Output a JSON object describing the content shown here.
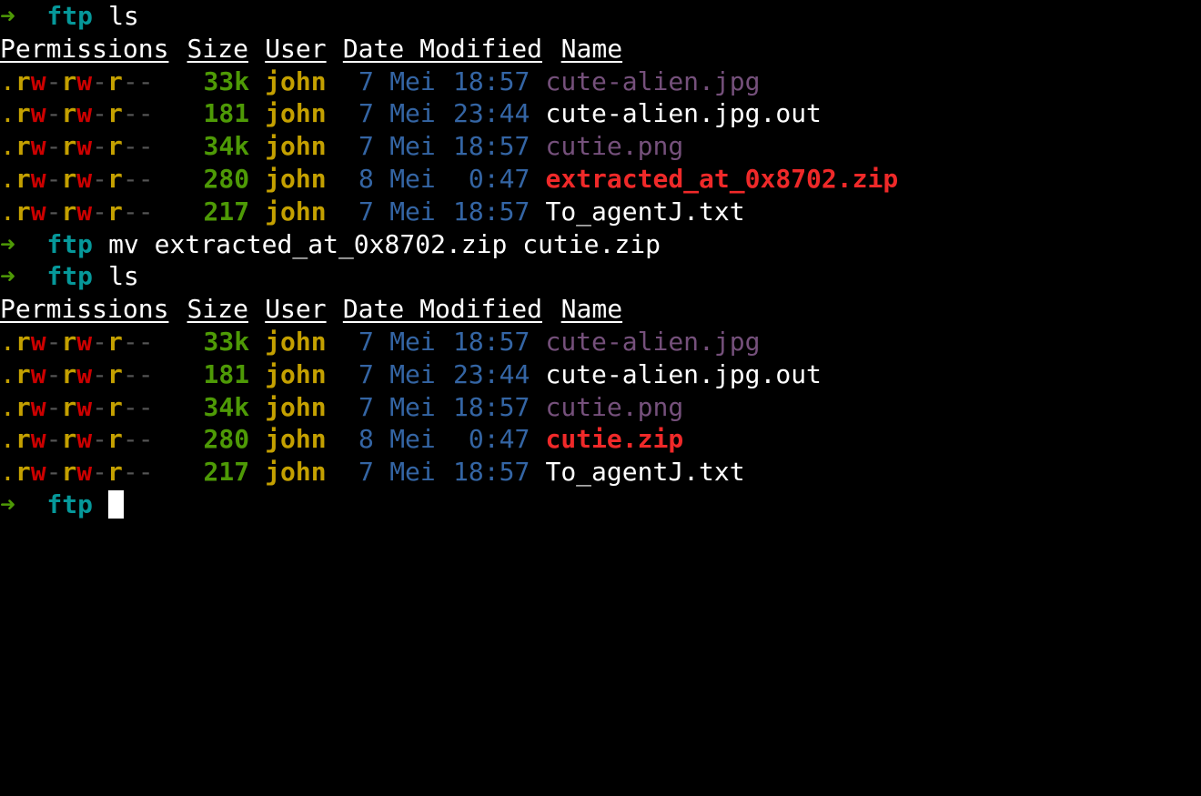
{
  "colors": {
    "background": "#000000",
    "prompt_arrow": "#4e9a06",
    "prompt_dir": "#06989a",
    "perm_dot": "#c4a000",
    "perm_read": "#c4a000",
    "perm_write": "#cc0000",
    "perm_dash": "#555555",
    "size": "#4e9a06",
    "user": "#c4a000",
    "date": "#3465a4",
    "file_image": "#75507b",
    "file_archive": "#ef2929",
    "file_plain": "#ffffff"
  },
  "prompt": {
    "arrow": "➜",
    "dir": "ftp"
  },
  "header": {
    "permissions": "Permissions",
    "size": "Size",
    "user": "User",
    "date_modified": "Date Modified",
    "name": "Name"
  },
  "commands": [
    "ls",
    "mv extracted_at_0x8702.zip cutie.zip",
    "ls"
  ],
  "listing_1": [
    {
      "perm": ".rw-rw-r--",
      "size": "33k",
      "user": "john",
      "day": "7",
      "month": "Mei",
      "time": "18:57",
      "name": "cute-alien.jpg",
      "type": "image"
    },
    {
      "perm": ".rw-rw-r--",
      "size": "181",
      "user": "john",
      "day": "7",
      "month": "Mei",
      "time": "23:44",
      "name": "cute-alien.jpg.out",
      "type": "plain"
    },
    {
      "perm": ".rw-rw-r--",
      "size": "34k",
      "user": "john",
      "day": "7",
      "month": "Mei",
      "time": "18:57",
      "name": "cutie.png",
      "type": "image"
    },
    {
      "perm": ".rw-rw-r--",
      "size": "280",
      "user": "john",
      "day": "8",
      "month": "Mei",
      "time": "0:47",
      "name": "extracted_at_0x8702.zip",
      "type": "archive"
    },
    {
      "perm": ".rw-rw-r--",
      "size": "217",
      "user": "john",
      "day": "7",
      "month": "Mei",
      "time": "18:57",
      "name": "To_agentJ.txt",
      "type": "plain"
    }
  ],
  "listing_2": [
    {
      "perm": ".rw-rw-r--",
      "size": "33k",
      "user": "john",
      "day": "7",
      "month": "Mei",
      "time": "18:57",
      "name": "cute-alien.jpg",
      "type": "image"
    },
    {
      "perm": ".rw-rw-r--",
      "size": "181",
      "user": "john",
      "day": "7",
      "month": "Mei",
      "time": "23:44",
      "name": "cute-alien.jpg.out",
      "type": "plain"
    },
    {
      "perm": ".rw-rw-r--",
      "size": "34k",
      "user": "john",
      "day": "7",
      "month": "Mei",
      "time": "18:57",
      "name": "cutie.png",
      "type": "image"
    },
    {
      "perm": ".rw-rw-r--",
      "size": "280",
      "user": "john",
      "day": "8",
      "month": "Mei",
      "time": "0:47",
      "name": "cutie.zip",
      "type": "archive"
    },
    {
      "perm": ".rw-rw-r--",
      "size": "217",
      "user": "john",
      "day": "7",
      "month": "Mei",
      "time": "18:57",
      "name": "To_agentJ.txt",
      "type": "plain"
    }
  ]
}
